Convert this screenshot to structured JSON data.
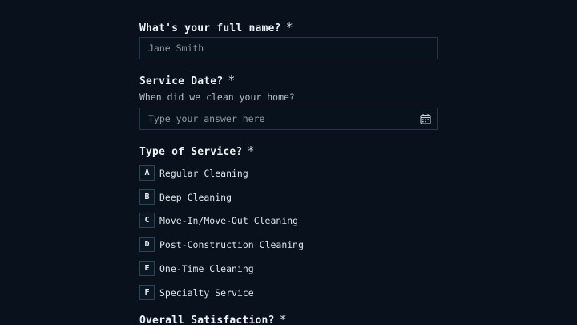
{
  "questions": {
    "name": {
      "title": "What's your full name?",
      "required_mark": "*",
      "placeholder": "Jane Smith"
    },
    "service_date": {
      "title": "Service Date?",
      "required_mark": "*",
      "description": "When did we clean your home?",
      "placeholder": "Type your answer here",
      "icon": "calendar-icon"
    },
    "service_type": {
      "title": "Type of Service?",
      "required_mark": "*",
      "options": [
        {
          "key": "A",
          "label": "Regular Cleaning"
        },
        {
          "key": "B",
          "label": "Deep Cleaning"
        },
        {
          "key": "C",
          "label": "Move-In/Move-Out Cleaning"
        },
        {
          "key": "D",
          "label": "Post-Construction Cleaning"
        },
        {
          "key": "E",
          "label": "One-Time Cleaning"
        },
        {
          "key": "F",
          "label": "Specialty Service"
        }
      ]
    },
    "satisfaction": {
      "title": "Overall Satisfaction?",
      "required_mark": "*"
    }
  },
  "colors": {
    "background": "#08111c",
    "input_border": "#1e3a4a",
    "text": "#e6edf3",
    "muted_text": "#8f9aa5"
  }
}
